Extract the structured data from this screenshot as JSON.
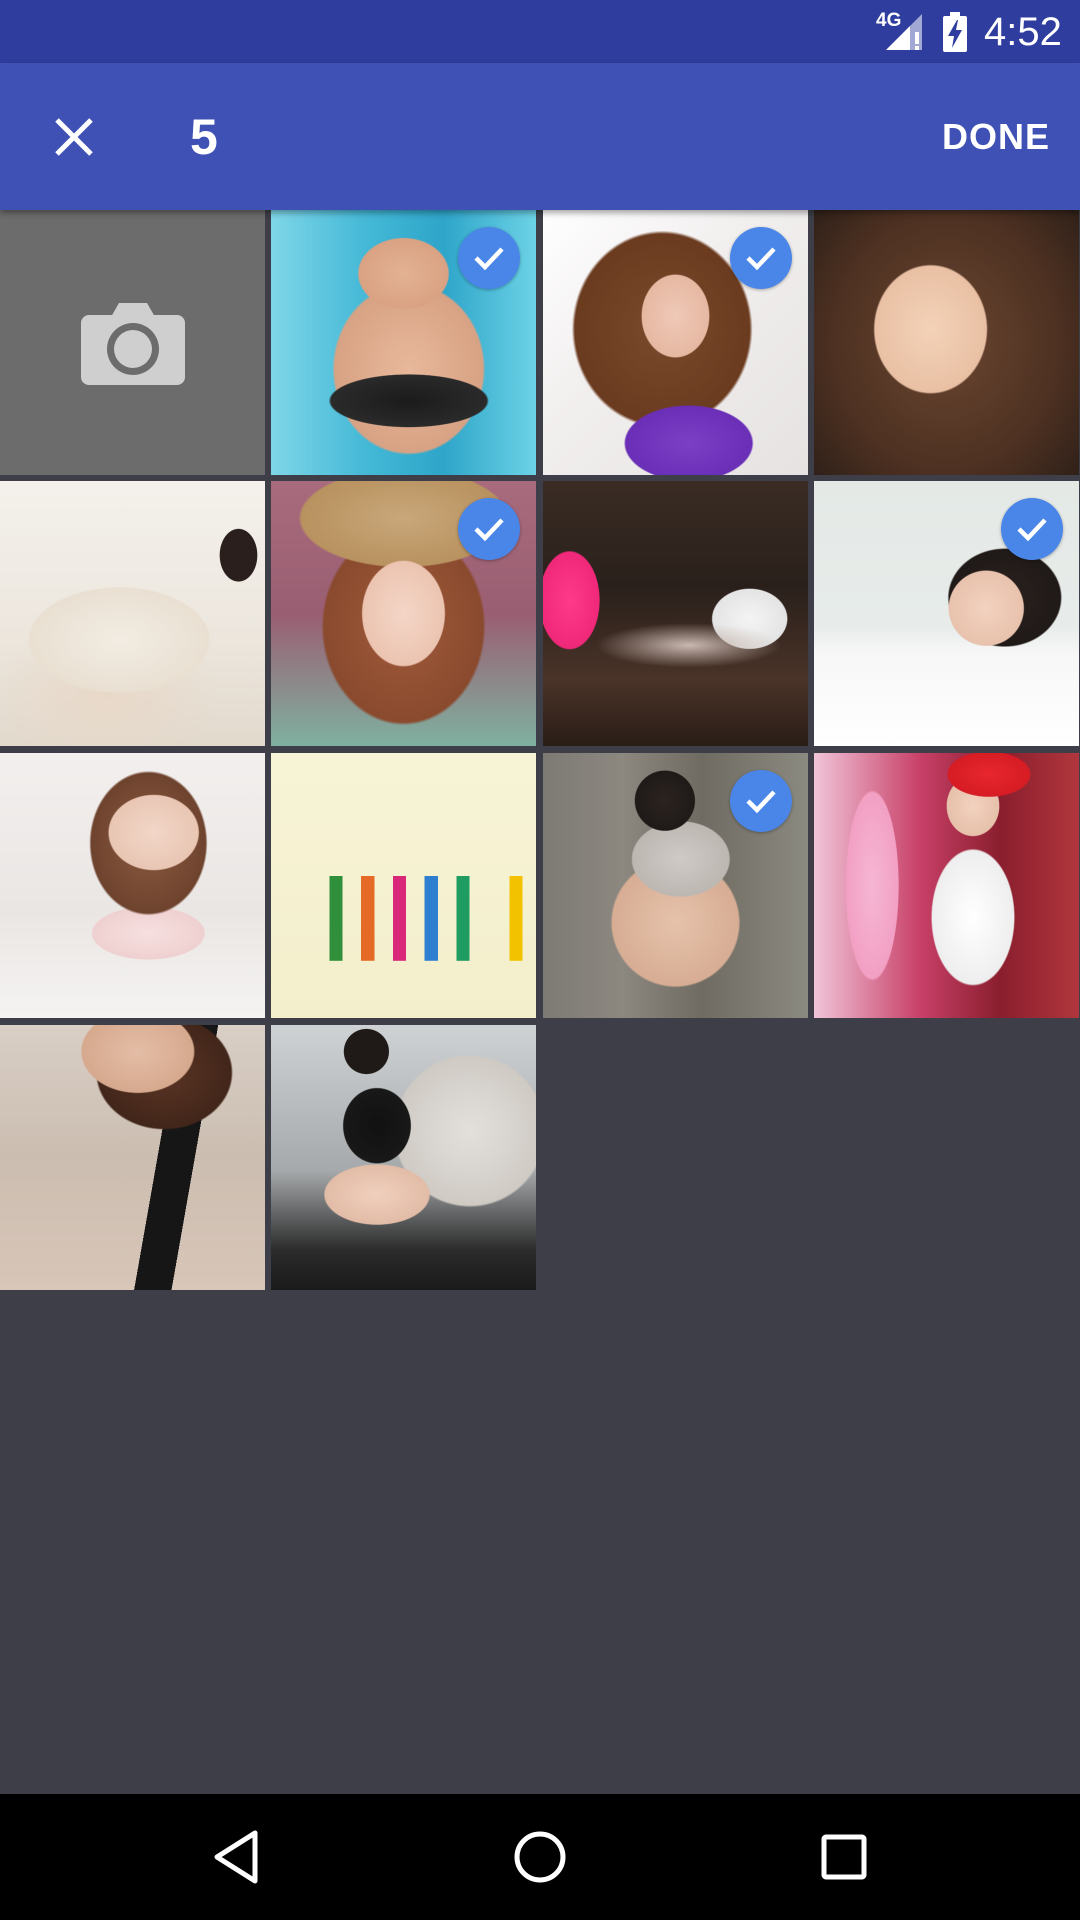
{
  "status_bar": {
    "network": "4G",
    "time": "4:52",
    "icons": [
      "signal-icon",
      "battery-charging-icon"
    ]
  },
  "app_bar": {
    "close_icon": "close-icon",
    "selected_count": "5",
    "done_label": "DONE"
  },
  "grid": {
    "camera_icon": "camera-icon",
    "tiles": [
      {
        "name": "photo-1",
        "selected": true
      },
      {
        "name": "photo-2",
        "selected": true
      },
      {
        "name": "photo-3",
        "selected": false
      },
      {
        "name": "photo-4",
        "selected": false
      },
      {
        "name": "photo-5",
        "selected": true
      },
      {
        "name": "photo-6",
        "selected": false
      },
      {
        "name": "photo-7",
        "selected": true
      },
      {
        "name": "photo-8",
        "selected": false
      },
      {
        "name": "photo-9",
        "selected": false
      },
      {
        "name": "photo-10",
        "selected": true
      },
      {
        "name": "photo-11",
        "selected": false
      },
      {
        "name": "photo-12",
        "selected": false
      },
      {
        "name": "photo-13",
        "selected": false
      }
    ]
  },
  "colors": {
    "status_bar": "#2f3e9e",
    "app_bar": "#3f51b5",
    "background": "#3d3e47",
    "check_badge": "#4a86e8",
    "nav_bar": "#000000"
  },
  "nav_bar": {
    "icons": [
      "back-icon",
      "home-icon",
      "recents-icon"
    ]
  }
}
